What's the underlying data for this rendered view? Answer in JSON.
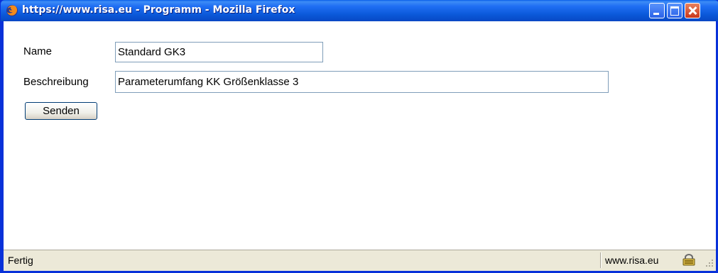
{
  "window": {
    "title": "https://www.risa.eu - Programm - Mozilla Firefox",
    "icon": "firefox-icon"
  },
  "form": {
    "name_label": "Name",
    "name_value": "Standard GK3",
    "description_label": "Beschreibung",
    "description_value": "Parameterumfang KK Größenklasse 3",
    "submit_label": "Senden"
  },
  "statusbar": {
    "status_text": "Fertig",
    "domain": "www.risa.eu",
    "security_icon": "lock-icon"
  }
}
